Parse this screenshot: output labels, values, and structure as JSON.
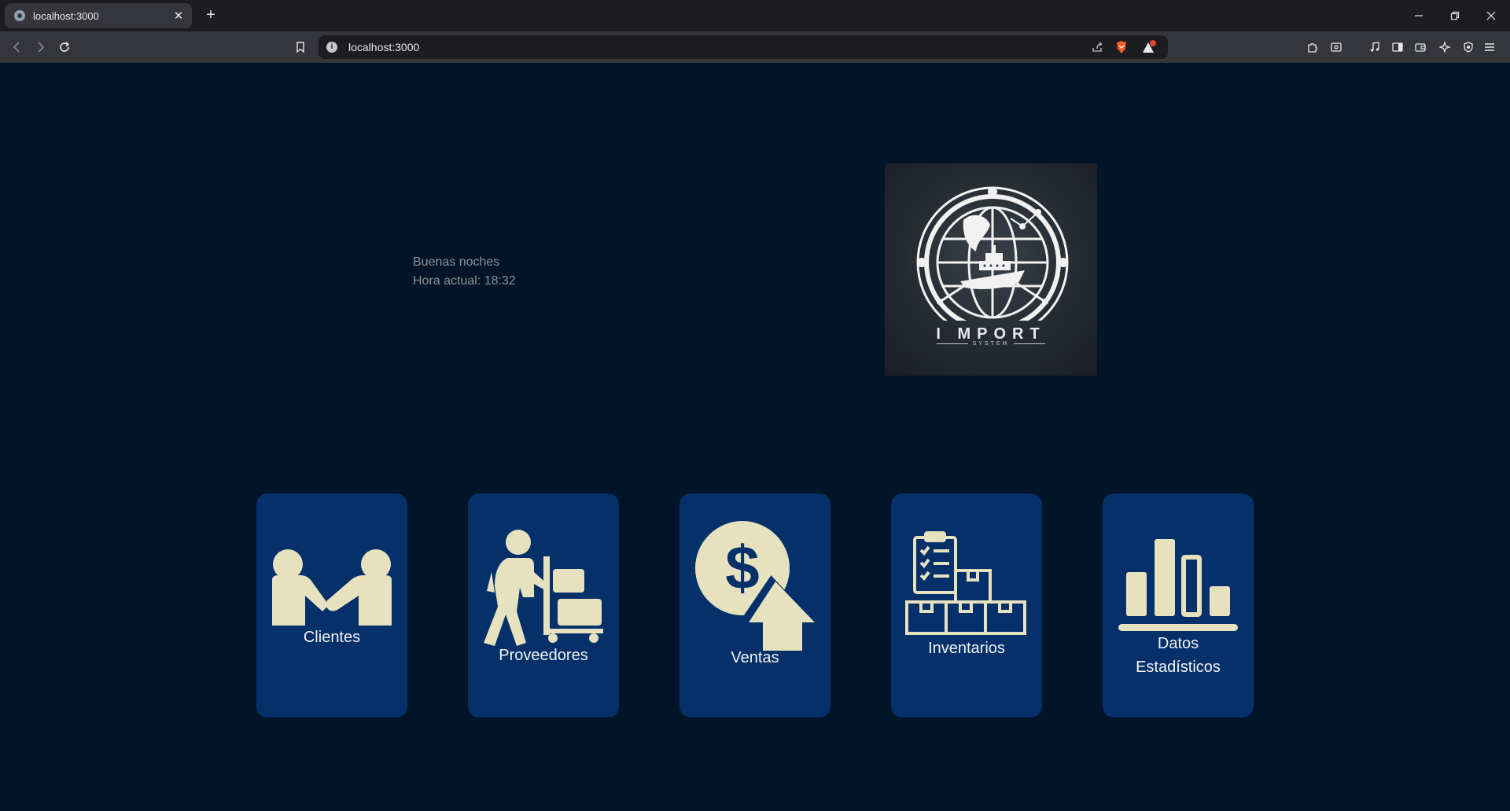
{
  "browser": {
    "tab_title": "localhost:3000",
    "new_tab": "+",
    "url": "localhost:3000",
    "window_controls": [
      "minimize",
      "restore",
      "close"
    ],
    "toolbar_icons": [
      "back-icon",
      "forward-icon",
      "reload-icon",
      "bookmark-icon",
      "share-icon",
      "brave-shields-icon",
      "brave-rewards-icon",
      "extensions-icon",
      "screenshot-icon",
      "media-icon",
      "sidebar-icon",
      "wallet-icon",
      "leo-ai-icon",
      "vpn-icon",
      "menu-icon"
    ]
  },
  "page": {
    "greeting": "Buenas noches",
    "time_label": "Hora actual: 18:32",
    "logo": {
      "brand": "I MPORT",
      "sub": "SYSTEM"
    },
    "cards": [
      {
        "label": "Clientes",
        "icon": "handshake-icon"
      },
      {
        "label": "Proveedores",
        "icon": "delivery-worker-icon"
      },
      {
        "label": "Ventas",
        "icon": "sales-dollar-icon"
      },
      {
        "label": "Inventarios",
        "icon": "inventory-clipboard-icon"
      },
      {
        "label_line1": "Datos",
        "label_line2": "Estadísticos",
        "icon": "bar-chart-icon"
      }
    ],
    "colors": {
      "background": "#021427",
      "card": "#06306a",
      "icon": "#e6e2c0",
      "greeting_text": "#8c9299"
    }
  }
}
